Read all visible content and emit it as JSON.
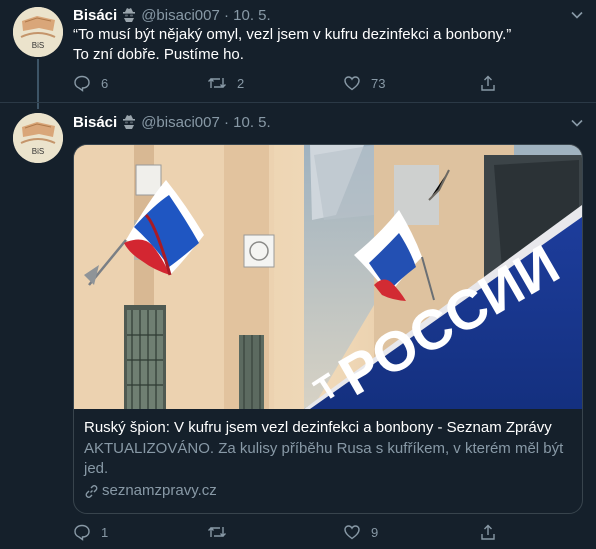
{
  "tweets": [
    {
      "name": "Bisáci",
      "handle": "@bisaci007",
      "date": "· 10. 5.",
      "avatar_text": "BiS",
      "text_line1": "“To musí být nějaký omyl, vezl jsem v kufru dezinfekci a bonbony.”",
      "text_line2": "To zní dobře. Pustíme ho.",
      "replies": "6",
      "retweets": "2",
      "likes": "73"
    },
    {
      "name": "Bisáci",
      "handle": "@bisaci007",
      "date": "· 10. 5.",
      "avatar_text": "BiS",
      "card": {
        "title": "Ruský špion: V kufru jsem vezl dezinfekci a bonbony - Seznam Zprávy",
        "description": "AKTUALIZOVÁNO. Za kulisy příběhu Rusa s kufříkem, v kterém měl být jed.",
        "domain": "seznamzpravy.cz",
        "sign_text": "РОССИИ",
        "sign_partial": "Т"
      },
      "replies": "1",
      "retweets": "",
      "likes": "9"
    }
  ],
  "colors": {
    "background": "#15202b",
    "muted": "#8899a6",
    "border": "#38444d"
  },
  "icons": [
    "spy-emoji-icon",
    "chevron-down-icon",
    "reply-icon",
    "retweet-icon",
    "like-icon",
    "share-icon",
    "link-icon"
  ]
}
